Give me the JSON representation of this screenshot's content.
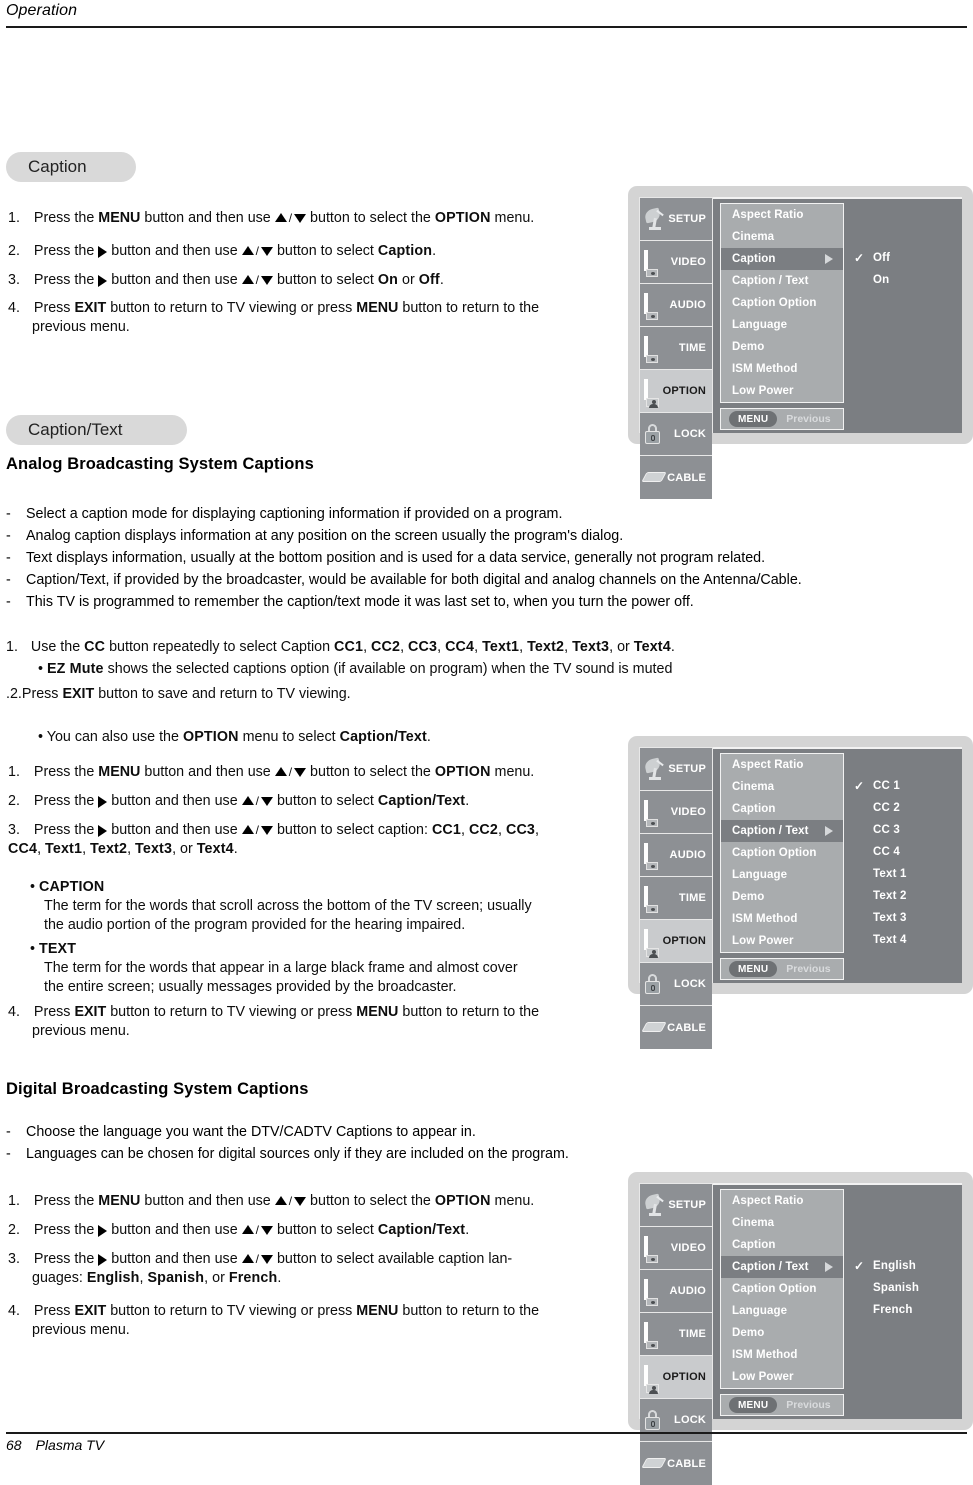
{
  "header": {
    "title": "Operation"
  },
  "footer": {
    "page": "68",
    "label": "Plasma TV"
  },
  "sections": {
    "caption_pill": "Caption",
    "caption_text_pill": "Caption/Text",
    "analog_heading": "Analog Broadcasting System Captions",
    "digital_heading": "Digital Broadcasting System Captions"
  },
  "caption_steps": {
    "s1": {
      "n": "1.",
      "a": "Press the ",
      "b1": "MENU",
      "c": " button and then use ",
      "d": " button to select the ",
      "b2": "OPTION",
      "e": " menu."
    },
    "s2": {
      "n": "2.",
      "a": "Press the ",
      "c": " button and then use ",
      "d": " button to select ",
      "b2": "Caption",
      "e": "."
    },
    "s3": {
      "n": "3.",
      "a": "Press the ",
      "c": " button and then use ",
      "d": " button to select ",
      "b2": "On",
      "e": " or ",
      "b3": "Off",
      "f": "."
    },
    "s4": {
      "n": "4.",
      "a": "Press ",
      "b1": "EXIT",
      "c": " button to return to TV viewing or press ",
      "b2": "MENU",
      "e": " button to return to the",
      "line2": "previous menu."
    }
  },
  "analog_bullets": [
    "Select a caption mode for displaying captioning information if provided on a program.",
    "Analog caption displays information at any position on the screen usually the program's dialog.",
    "Text displays information, usually at the bottom position and is used for a data service, generally not program related.",
    "Caption/Text, if provided by the broadcaster, would be available for both digital and analog channels on the Antenna/Cable.",
    "This TV is programmed to remember the caption/text mode it was last set to, when you turn the power off."
  ],
  "analog_steps": {
    "cc_line": {
      "n": "1.",
      "a": "Use the ",
      "b1": "CC",
      "c": " button repeatedly to select Caption ",
      "opts": [
        "CC1",
        "CC2",
        "CC3",
        "CC4",
        "Text1",
        "Text2",
        "Text3"
      ],
      "or": ", or ",
      "last": "Text4",
      "end": "."
    },
    "ez": {
      "bullet": "• ",
      "b1": "EZ Mute",
      "rest": " shows the selected captions option (if available on program) when the TV sound is muted"
    },
    "exit": {
      "n": ".2.",
      "a": "Press ",
      "b1": "EXIT",
      "rest": " button to save and return to TV viewing."
    },
    "also": {
      "bullet": "• ",
      "a": "You can also use the ",
      "b1": "OPTION",
      "c": " menu to select ",
      "b2": "Caption/Text",
      "e": "."
    }
  },
  "ct_steps": {
    "s1": {
      "n": "1.",
      "a": "Press the ",
      "b1": "MENU",
      "c": " button and then use ",
      "d": " button to select the ",
      "b2": "OPTION",
      "e": " menu."
    },
    "s2": {
      "n": "2.",
      "a": "Press the ",
      "c": " button and then use ",
      "d": " button to select ",
      "b2": "Caption/Text",
      "e": "."
    },
    "s3": {
      "n": "3.",
      "a": "Press the ",
      "c": " button and then use ",
      "d": " button to select caption: ",
      "o1": "CC1",
      "o2": "CC2",
      "o3": "CC3",
      "line2": [
        "CC4",
        "Text1",
        "Text2",
        "Text3"
      ],
      "or": ", or ",
      "last": "Text4",
      "end": "."
    },
    "caption_def": {
      "bullet": "• ",
      "title": "CAPTION",
      "l1": "The term for the words that scroll across the bottom of the TV screen; usually",
      "l2": "the audio portion of the program provided for the hearing impaired."
    },
    "text_def": {
      "bullet": "• ",
      "title": "TEXT",
      "l1": "The term for the words that appear in a large black frame and almost cover",
      "l2": "the entire screen; usually messages provided by the broadcaster."
    },
    "s4": {
      "n": "4.",
      "a": "Press ",
      "b1": "EXIT",
      "c": " button to return to TV viewing or press ",
      "b2": "MENU",
      "e": " button to return to the",
      "line2": "previous menu."
    }
  },
  "digital_bullets": [
    "Choose the language you want the DTV/CADTV Captions to appear in.",
    "Languages can be chosen for digital sources only if they are included on the program."
  ],
  "digital_steps": {
    "s1": {
      "n": "1.",
      "a": "Press the ",
      "b1": "MENU",
      "c": " button and then use ",
      "d": " button to select the ",
      "b2": "OPTION",
      "e": " menu."
    },
    "s2": {
      "n": "2.",
      "a": "Press the ",
      "c": " button and then use ",
      "d": " button to select ",
      "b2": "Caption/Text",
      "e": "."
    },
    "s3": {
      "n": "3.",
      "a": "Press the ",
      "c": "  button and then use ",
      "d": " button to  select  available  caption  lan-",
      "line2a": "guages: ",
      "l1": "English",
      "l2": "Spanish",
      "or": ", or ",
      "l3": "French",
      "end": "."
    },
    "s4": {
      "n": "4.",
      "a": "Press ",
      "b1": "EXIT",
      "c": " button to return to TV viewing or press ",
      "b2": "MENU",
      "e": " button to return to the",
      "line2": "previous menu."
    }
  },
  "osd": {
    "sidebar": [
      {
        "label": "SETUP",
        "icon": "satellite-dish-icon"
      },
      {
        "label": "VIDEO",
        "icon": "screen-icon"
      },
      {
        "label": "AUDIO",
        "icon": "screen-icon"
      },
      {
        "label": "TIME",
        "icon": "screen-icon"
      },
      {
        "label": "OPTION",
        "icon": "screen-icon"
      },
      {
        "label": "LOCK",
        "icon": "padlock-icon"
      },
      {
        "label": "CABLE",
        "icon": "cable-plug-icon"
      }
    ],
    "menu_items": [
      "Aspect Ratio",
      "Cinema",
      "Caption",
      "Caption / Text",
      "Caption Option",
      "Language",
      "Demo",
      "ISM Method",
      "Low Power"
    ],
    "menubar": {
      "chip": "MENU",
      "label": "Previous"
    },
    "panel1": {
      "highlight": "Caption",
      "options": [
        "Off",
        "On"
      ],
      "checked": "Off"
    },
    "panel2": {
      "highlight": "Caption / Text",
      "options": [
        "CC 1",
        "CC 2",
        "CC 3",
        "CC 4",
        "Text 1",
        "Text 2",
        "Text 3",
        "Text 4"
      ],
      "checked": "CC 1"
    },
    "panel3": {
      "highlight": "Caption / Text",
      "options": [
        "English",
        "Spanish",
        "French"
      ],
      "checked": "English"
    }
  },
  "colors": {
    "osd_frame": "#d4d4d4",
    "osd_right_panel": "#7b7e82",
    "osd_list": "#a9acae",
    "osd_sidebar": "#8d9094",
    "osd_selected": "#c9cbcd",
    "pill": "#d9d9d9"
  }
}
